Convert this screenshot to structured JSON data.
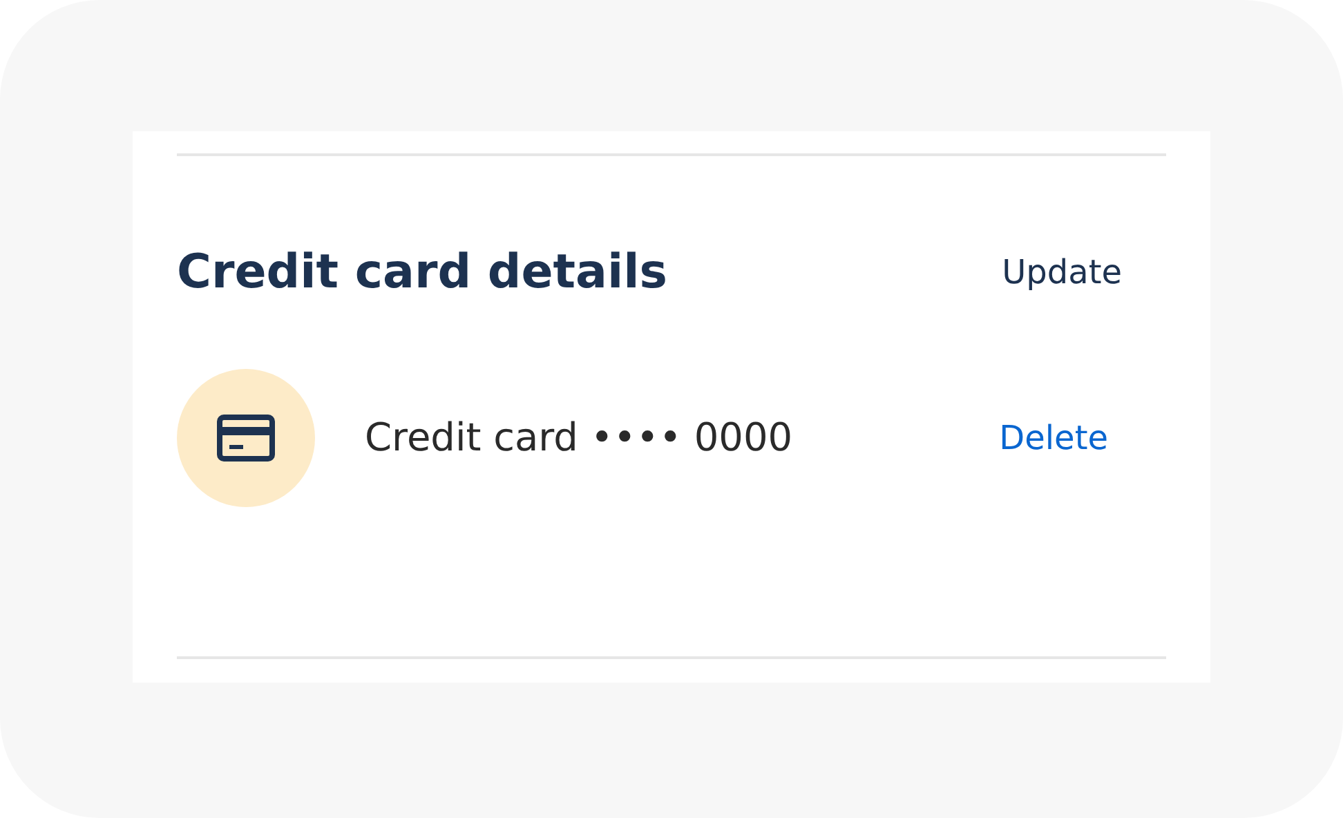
{
  "section": {
    "title": "Credit card details",
    "action": "Update"
  },
  "cards": [
    {
      "label": "Credit card •••• 0000",
      "action": "Delete"
    }
  ]
}
